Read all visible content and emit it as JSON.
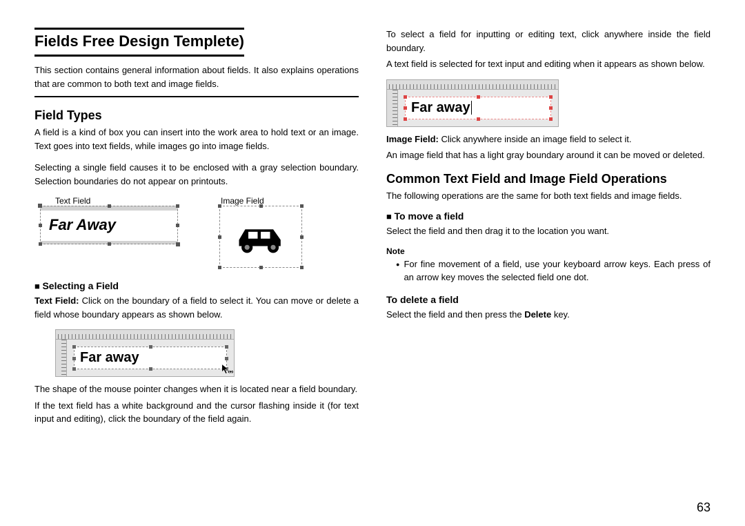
{
  "page_number": "63",
  "left": {
    "main_title": "Fields Free Design Templete)",
    "intro": "This section contains general information about fields. It also explains operations that are common to both text and image fields.",
    "h2_field_types": "Field Types",
    "field_types_p1": "A field is a kind of box you can insert into the work area to hold text or an image. Text goes into text fields, while images go into image fields.",
    "field_types_p2": "Selecting a single field causes it to be enclosed with a gray selection boundary. Selection boundaries do not appear on printouts.",
    "label_text_field": "Text Field",
    "label_image_field": "Image Field",
    "fig_text_field_content": "Far Away",
    "h3_selecting": "Selecting a Field",
    "selecting_body_prefix": "Text Field:",
    "selecting_body": " Click on the boundary of a field to select it. You can move or delete a field whose boundary appears as shown below.",
    "fig_ruler1_content": "Far away",
    "shape_body": "The shape of the mouse pointer changes when it is located near a field boundary.",
    "flashing_body": "If the text field has a white background and the cursor flashing inside it (for text input and editing), click the boundary of the field again."
  },
  "right": {
    "select_body": "To select a field for inputting or editing text, click anywhere inside the field boundary.",
    "shown_body": "A text field is selected for text input and editing when it appears as shown below.",
    "fig_ruler2_content": "Far away",
    "image_field_prefix": "Image Field:",
    "image_field_body": " Click anywhere inside an image field to select it.",
    "image_field_body2": "An image field that has a light gray boundary around it can be moved or deleted.",
    "h2_common": "Common Text Field and Image Field Operations",
    "common_body": "The following operations are the same for both text fields and image fields.",
    "h3_move": "To move a field",
    "move_body": "Select the field and then drag it to the location you want.",
    "note_label": "Note",
    "note_body": "For fine movement of a field, use your keyboard arrow keys. Each press of an arrow key moves the selected field one dot.",
    "h3_delete": "To delete a field",
    "delete_body_pre": "Select the field and then press the ",
    "delete_key": "Delete",
    "delete_body_post": " key."
  }
}
